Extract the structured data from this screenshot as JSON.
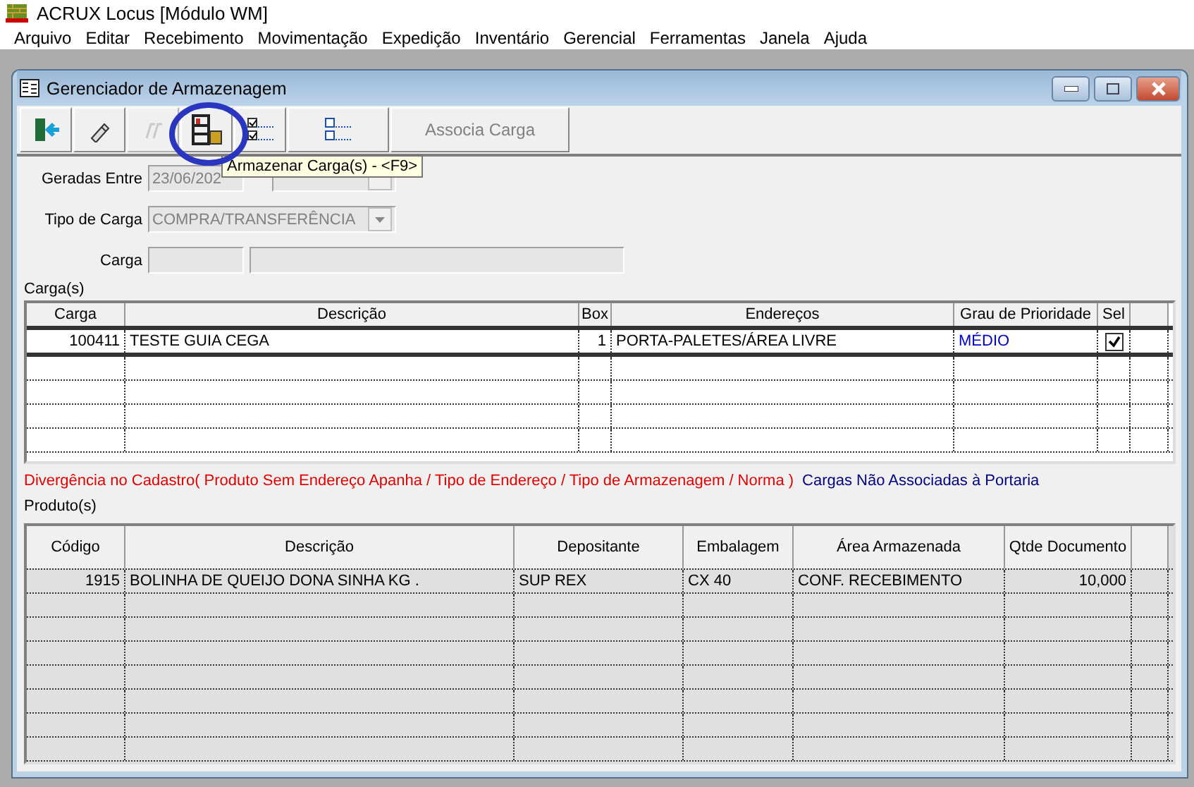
{
  "app_title": "ACRUX Locus [Módulo WM]",
  "menu": [
    "Arquivo",
    "Editar",
    "Recebimento",
    "Movimentação",
    "Expedição",
    "Inventário",
    "Gerencial",
    "Ferramentas",
    "Janela",
    "Ajuda"
  ],
  "window": {
    "title": "Gerenciador de Armazenagem"
  },
  "toolbar": [
    {
      "kind": "icon",
      "disabled": false
    },
    {
      "kind": "icon",
      "disabled": false
    },
    {
      "kind": "icon",
      "disabled": true
    },
    {
      "kind": "icon",
      "disabled": false,
      "highlighted": true
    },
    {
      "kind": "icon",
      "disabled": false
    },
    {
      "kind": "icon",
      "disabled": false
    },
    {
      "kind": "text",
      "label": "Associa Carga",
      "disabled": true
    }
  ],
  "tooltip": {
    "text": "Armazenar Carga(s) - <F9>"
  },
  "filters": {
    "date_label": "Geradas Entre",
    "date_from": "23/06/202",
    "type_label": "Tipo de Carga",
    "type_value": "COMPRA/TRANSFERÊNCIA",
    "load_label": "Carga"
  },
  "loads": {
    "label": "Carga(s)",
    "columns": [
      "Carga",
      "Descrição",
      "Box",
      "Endereços",
      "Grau de Prioridade",
      "Sel"
    ],
    "rows": [
      {
        "cells": [
          "100411",
          "TESTE GUIA CEGA",
          "1",
          "PORTA-PALETES/ÁREA LIVRE",
          "MÉDIO"
        ],
        "checked": true
      }
    ]
  },
  "legend": [
    {
      "text": "Divergência no Cadastro( Produto Sem Endereço Apanha / Tipo de Endereço / Tipo de Armazenagem / Norma )",
      "color": "#e00000"
    },
    {
      "text": "Cargas Não Associadas à Portaria",
      "color": "#000080"
    }
  ],
  "products": {
    "label": "Produto(s)",
    "columns": [
      "Código",
      "Descrição",
      "Depositante",
      "Embalagem",
      "Área Armazenada",
      "Qtde Documento"
    ],
    "rows": [
      [
        "1915",
        "BOLINHA DE QUEIJO DONA SINHA KG .",
        "SUP REX",
        "CX 40",
        "CONF. RECEBIMENTO",
        "10,000"
      ]
    ]
  }
}
